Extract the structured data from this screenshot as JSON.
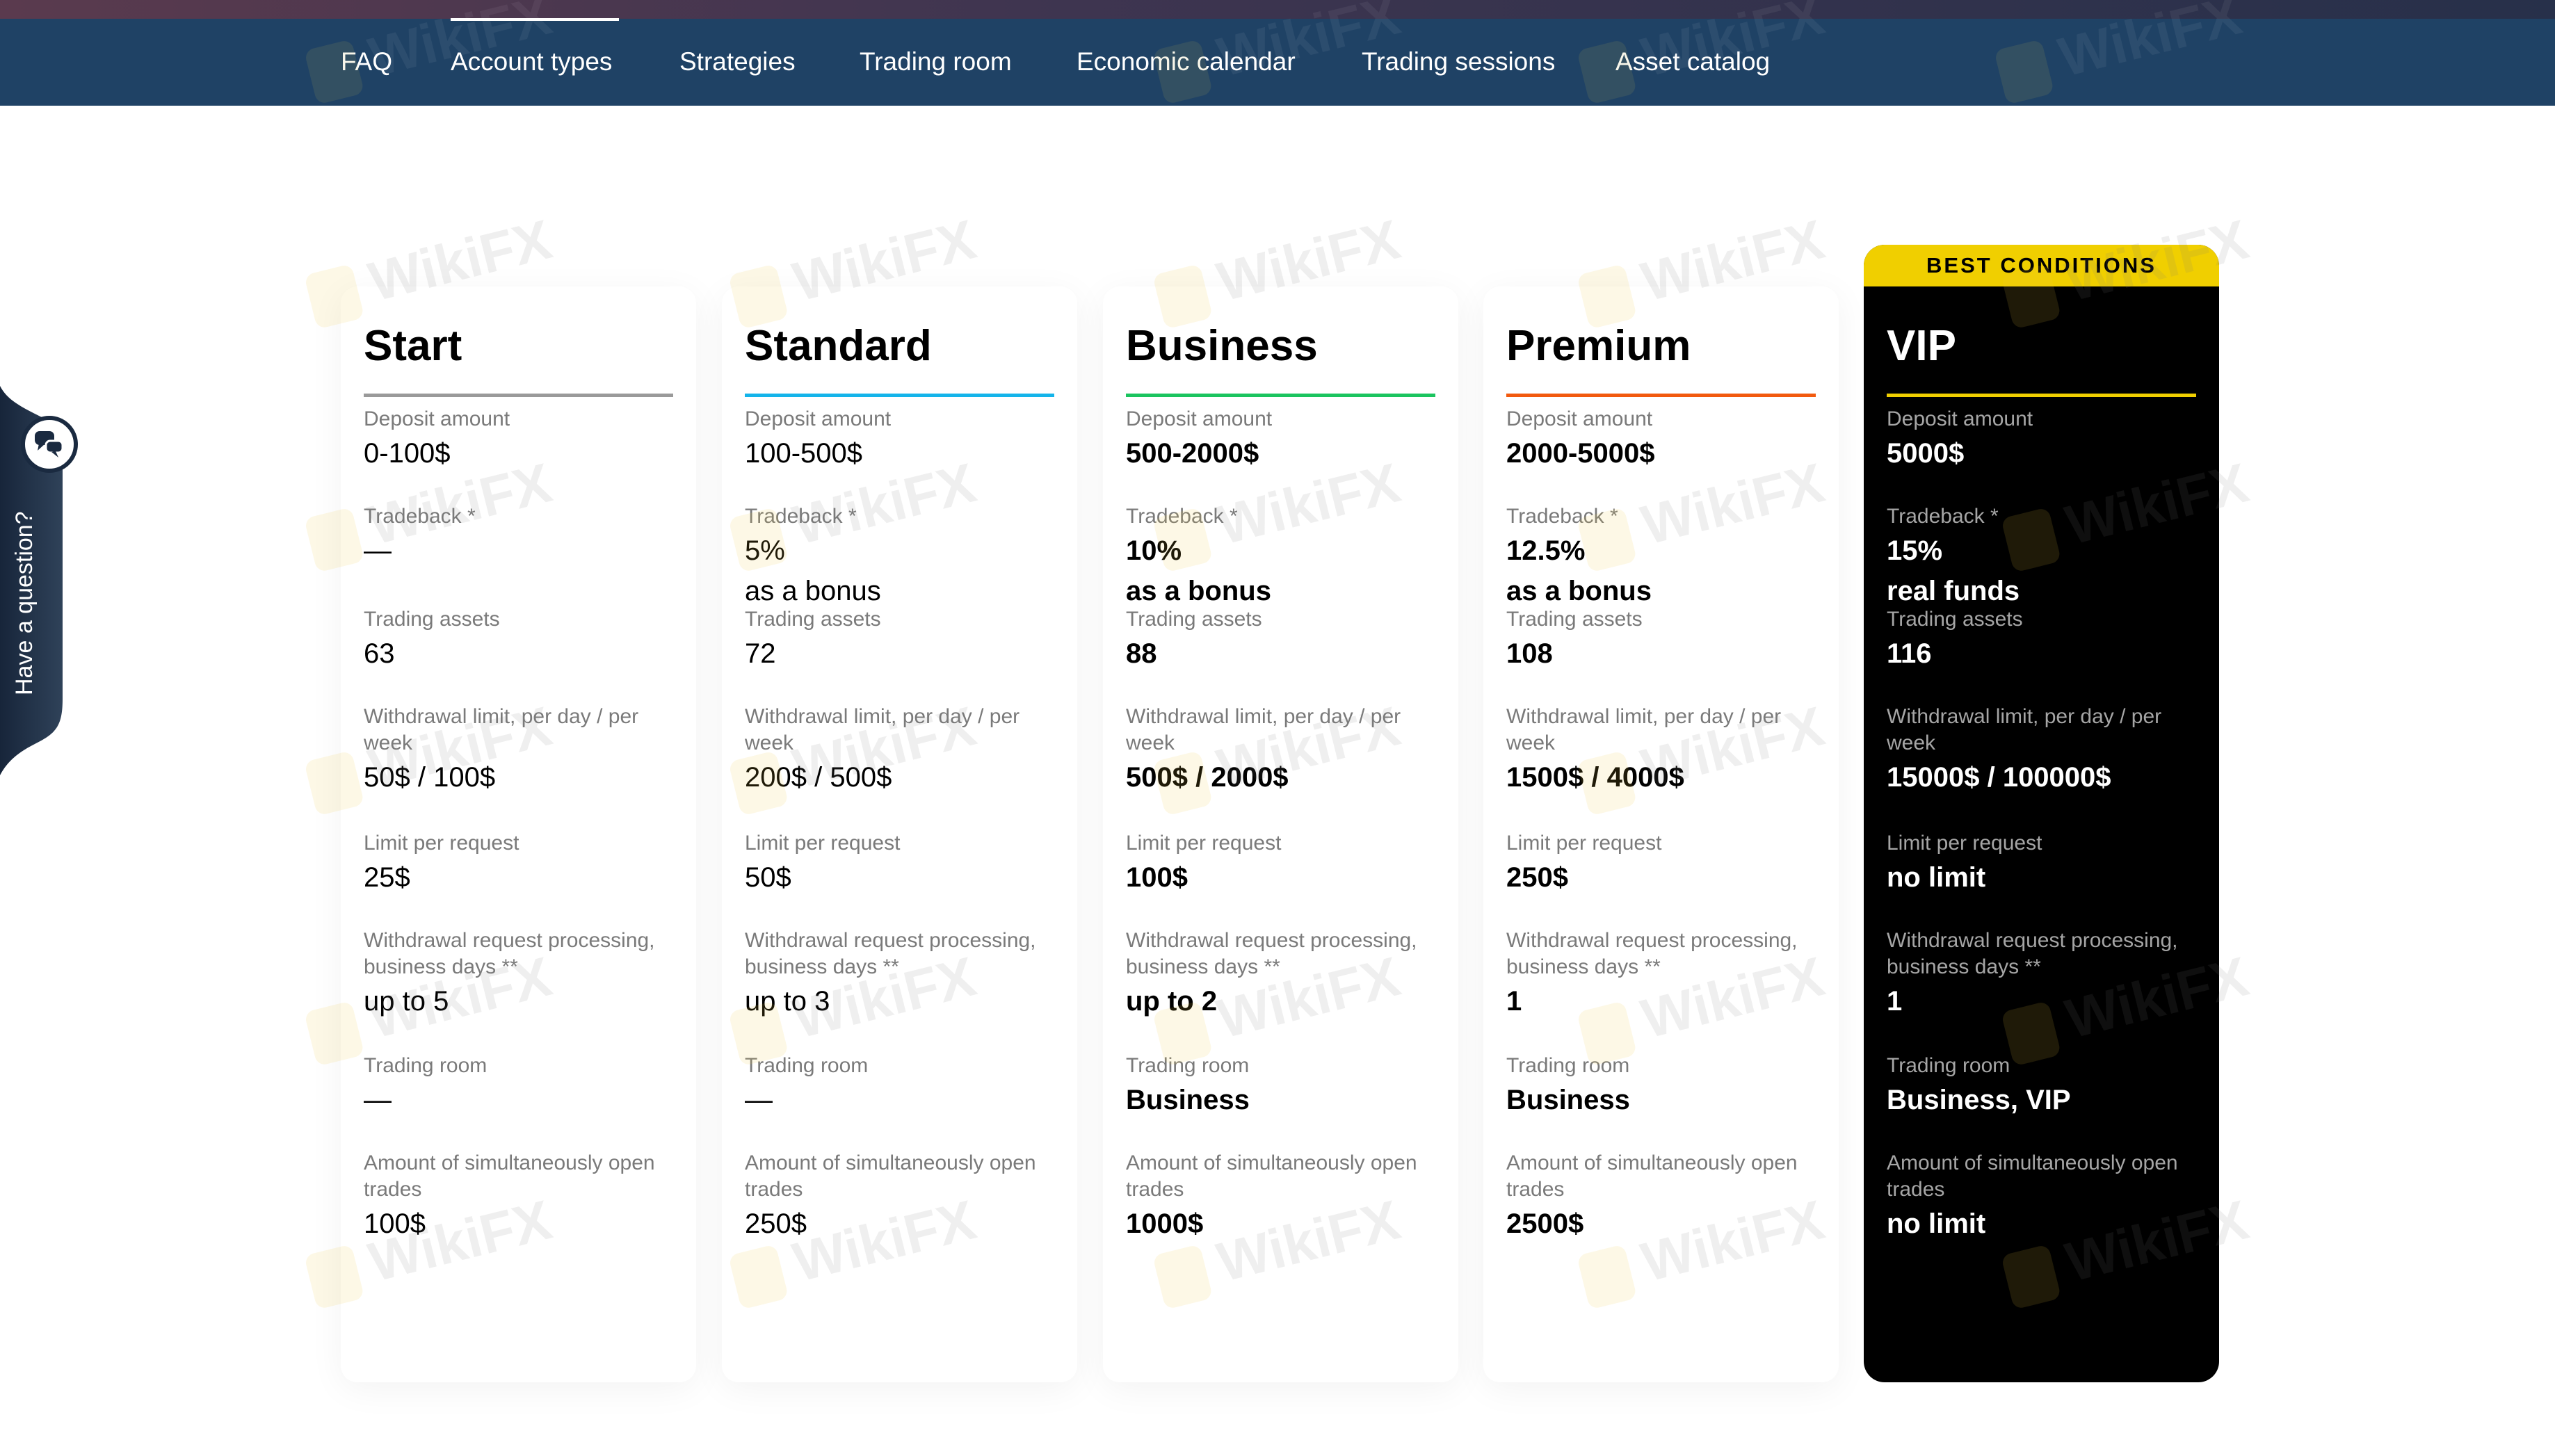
{
  "nav": {
    "items": [
      {
        "label": "FAQ",
        "active": false
      },
      {
        "label": "Account types",
        "active": true
      },
      {
        "label": "Strategies",
        "active": false
      },
      {
        "label": "Trading room",
        "active": false
      },
      {
        "label": "Economic calendar",
        "active": false
      },
      {
        "label": "Trading sessions",
        "active": false
      },
      {
        "label": "Asset catalog",
        "active": false
      }
    ]
  },
  "side_widget": {
    "label": "Have a question?",
    "icon": "chat-bubbles-icon"
  },
  "watermark": "WikiFX",
  "accounts": [
    {
      "name": "Start",
      "accent": "#9a9a9a",
      "fields": [
        {
          "label": "Deposit amount",
          "value": "0-100$"
        },
        {
          "label": "Tradeback *",
          "value": "—",
          "value2": ""
        },
        {
          "label": "Trading assets",
          "value": "63"
        },
        {
          "label": "Withdrawal limit, per day / per week",
          "value": "50$ / 100$"
        },
        {
          "label": "Limit per request",
          "value": "25$"
        },
        {
          "label": "Withdrawal request processing, business days **",
          "value": "up to 5"
        },
        {
          "label": "Trading room",
          "value": "—"
        },
        {
          "label": "Amount of simultaneously open trades",
          "value": "100$"
        }
      ]
    },
    {
      "name": "Standard",
      "accent": "#14b4ea",
      "fields": [
        {
          "label": "Deposit amount",
          "value": "100-500$"
        },
        {
          "label": "Tradeback *",
          "value": "5%",
          "value2": "as a bonus"
        },
        {
          "label": "Trading assets",
          "value": "72"
        },
        {
          "label": "Withdrawal limit, per day / per week",
          "value": "200$ / 500$"
        },
        {
          "label": "Limit per request",
          "value": "50$"
        },
        {
          "label": "Withdrawal request processing, business days **",
          "value": "up to 3"
        },
        {
          "label": "Trading room",
          "value": "—"
        },
        {
          "label": "Amount of simultaneously open trades",
          "value": "250$"
        }
      ]
    },
    {
      "name": "Business",
      "accent": "#1bc45f",
      "fields": [
        {
          "label": "Deposit amount",
          "value": "500-2000$"
        },
        {
          "label": "Tradeback *",
          "value": "10%",
          "value2": "as a bonus"
        },
        {
          "label": "Trading assets",
          "value": "88"
        },
        {
          "label": "Withdrawal limit, per day / per week",
          "value": "500$ / 2000$"
        },
        {
          "label": "Limit per request",
          "value": "100$"
        },
        {
          "label": "Withdrawal request processing, business days **",
          "value": "up to 2"
        },
        {
          "label": "Trading room",
          "value": "Business"
        },
        {
          "label": "Amount of simultaneously open trades",
          "value": "1000$"
        }
      ]
    },
    {
      "name": "Premium",
      "accent": "#f25a0f",
      "fields": [
        {
          "label": "Deposit amount",
          "value": "2000-5000$"
        },
        {
          "label": "Tradeback *",
          "value": "12.5%",
          "value2": "as a bonus"
        },
        {
          "label": "Trading assets",
          "value": "108"
        },
        {
          "label": "Withdrawal limit, per day / per week",
          "value": "1500$ / 4000$"
        },
        {
          "label": "Limit per request",
          "value": "250$"
        },
        {
          "label": "Withdrawal request processing, business days **",
          "value": "1"
        },
        {
          "label": "Trading room",
          "value": "Business"
        },
        {
          "label": "Amount of simultaneously open trades",
          "value": "2500$"
        }
      ]
    },
    {
      "name": "VIP",
      "accent": "#f0cf00",
      "badge": "BEST CONDITIONS",
      "fields": [
        {
          "label": "Deposit amount",
          "value": "5000$"
        },
        {
          "label": "Tradeback *",
          "value": "15%",
          "value2": "real funds"
        },
        {
          "label": "Trading assets",
          "value": "116"
        },
        {
          "label": "Withdrawal limit, per day / per week",
          "value": "15000$ / 100000$"
        },
        {
          "label": "Limit per request",
          "value": "no limit"
        },
        {
          "label": "Withdrawal request processing, business days **",
          "value": "1"
        },
        {
          "label": "Trading room",
          "value": "Business, VIP"
        },
        {
          "label": "Amount of simultaneously open trades",
          "value": "no limit"
        }
      ]
    }
  ]
}
